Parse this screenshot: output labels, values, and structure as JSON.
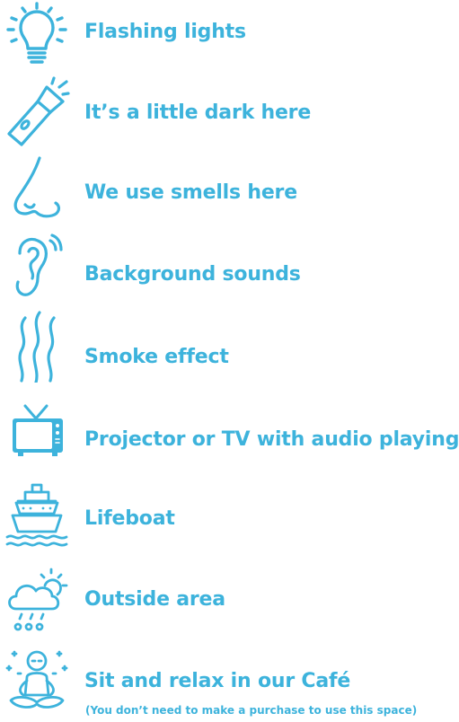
{
  "colors": {
    "accent": "#3db3dc",
    "white": "#ffffff"
  },
  "items": [
    {
      "icon": "lightbulb-icon",
      "label": "Flashing lights"
    },
    {
      "icon": "flashlight-icon",
      "label": "It’s a little dark here"
    },
    {
      "icon": "nose-icon",
      "label": "We use smells here"
    },
    {
      "icon": "ear-icon",
      "label": "Background sounds"
    },
    {
      "icon": "smoke-icon",
      "label": "Smoke effect"
    },
    {
      "icon": "tv-icon",
      "label": "Projector or TV with audio playing"
    },
    {
      "icon": "lifeboat-icon",
      "label": "Lifeboat"
    },
    {
      "icon": "cloud-rain-sun-icon",
      "label": "Outside area"
    },
    {
      "icon": "meditating-person-icon",
      "label": "Sit and relax in our Café",
      "note": "(You don’t need to make a purchase to use this space)"
    }
  ]
}
